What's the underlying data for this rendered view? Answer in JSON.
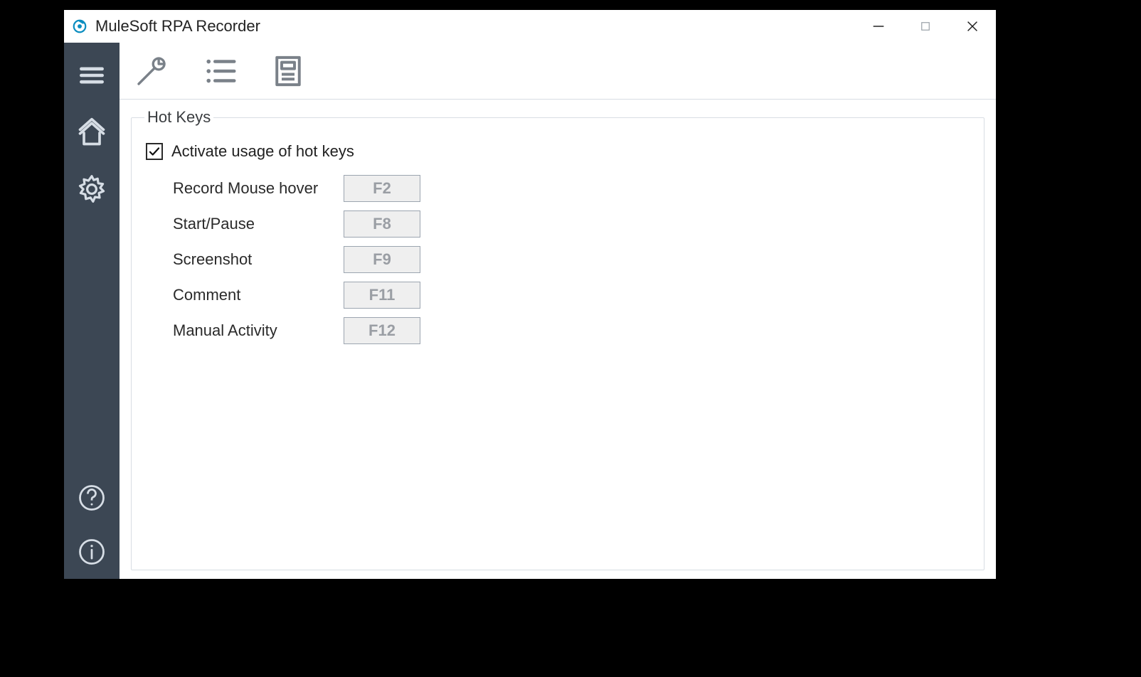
{
  "app": {
    "title": "MuleSoft RPA Recorder"
  },
  "group": {
    "legend": "Hot Keys",
    "checkbox_label": "Activate usage of hot keys",
    "checkbox_checked": true
  },
  "hotkeys": [
    {
      "label": "Record Mouse hover",
      "key": "F2"
    },
    {
      "label": "Start/Pause",
      "key": "F8"
    },
    {
      "label": "Screenshot",
      "key": "F9"
    },
    {
      "label": "Comment",
      "key": "F11"
    },
    {
      "label": "Manual Activity",
      "key": "F12"
    }
  ]
}
